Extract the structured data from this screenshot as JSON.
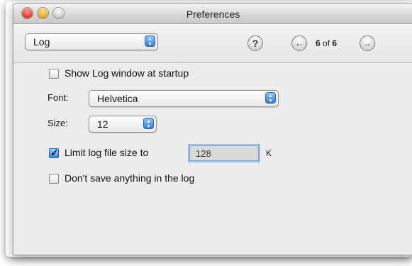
{
  "window": {
    "title": "Preferences"
  },
  "toolbar": {
    "panel_popup": {
      "selected": "Log"
    },
    "help_icon": "question-mark-icon",
    "pager": {
      "current": "6",
      "of_label": "of",
      "total": "6"
    }
  },
  "log_prefs": {
    "show_log_window": {
      "label": "Show Log window at startup",
      "checked": false
    },
    "font": {
      "label": "Font:",
      "selected": "Helvetica"
    },
    "size": {
      "label": "Size:",
      "selected": "12"
    },
    "limit_size": {
      "label": "Limit log file size to",
      "checked": true,
      "value": "128",
      "unit": "K"
    },
    "dont_save": {
      "label": "Don't save anything in the log",
      "checked": false
    }
  },
  "colors": {
    "accent_blue": "#3b86de",
    "close_red": "#e0301e",
    "minimize_yellow": "#e2a017"
  }
}
